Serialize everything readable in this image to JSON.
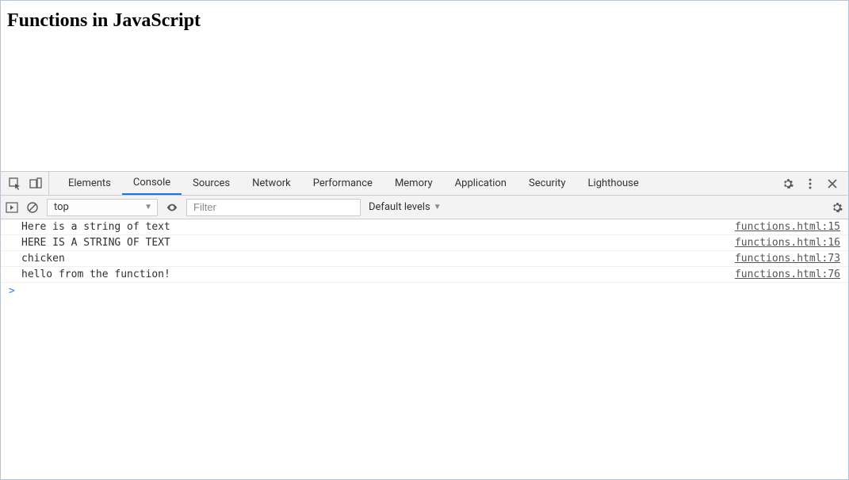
{
  "page": {
    "heading": "Functions in JavaScript"
  },
  "devtools": {
    "tabs": [
      {
        "label": "Elements",
        "active": false
      },
      {
        "label": "Console",
        "active": true
      },
      {
        "label": "Sources",
        "active": false
      },
      {
        "label": "Network",
        "active": false
      },
      {
        "label": "Performance",
        "active": false
      },
      {
        "label": "Memory",
        "active": false
      },
      {
        "label": "Application",
        "active": false
      },
      {
        "label": "Security",
        "active": false
      },
      {
        "label": "Lighthouse",
        "active": false
      }
    ],
    "console_toolbar": {
      "context": "top",
      "filter_placeholder": "Filter",
      "levels_label": "Default levels"
    },
    "logs": [
      {
        "message": "Here is a string of text",
        "source": "functions.html:15"
      },
      {
        "message": "HERE IS A STRING OF TEXT",
        "source": "functions.html:16"
      },
      {
        "message": "chicken",
        "source": "functions.html:73"
      },
      {
        "message": "hello from the function!",
        "source": "functions.html:76"
      }
    ],
    "prompt_symbol": ">"
  }
}
